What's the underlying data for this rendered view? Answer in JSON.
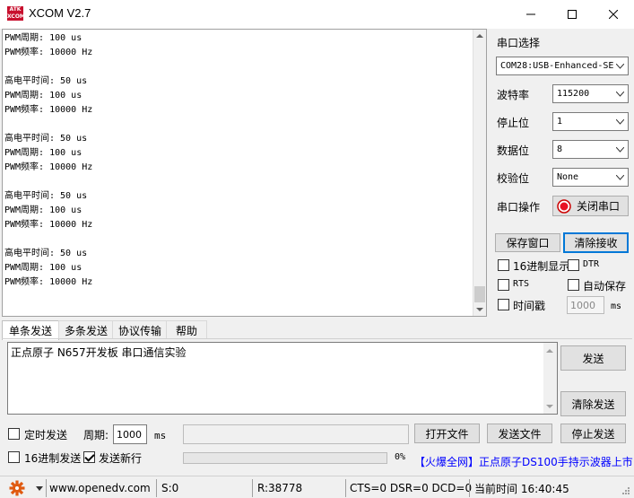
{
  "window": {
    "title": "XCOM V2.7",
    "logo_text": "ATK\nXCOM",
    "minimize": "─",
    "maximize": "☐",
    "close": "✕"
  },
  "receive": {
    "text": "PWM周期: 100 us\nPWM频率: 10000 Hz\n\n高电平时间: 50 us\nPWM周期: 100 us\nPWM频率: 10000 Hz\n\n高电平时间: 50 us\nPWM周期: 100 us\nPWM频率: 10000 Hz\n\n高电平时间: 50 us\nPWM周期: 100 us\nPWM频率: 10000 Hz\n\n高电平时间: 50 us\nPWM周期: 100 us\nPWM频率: 10000 Hz"
  },
  "settings": {
    "port_select_label": "串口选择",
    "port_value": "COM28:USB-Enhanced-SE",
    "baud_label": "波特率",
    "baud_value": "115200",
    "stopbit_label": "停止位",
    "stopbit_value": "1",
    "databit_label": "数据位",
    "databit_value": "8",
    "parity_label": "校验位",
    "parity_value": "None",
    "port_op_label": "串口操作",
    "close_port_button": "关闭串口",
    "save_window_button": "保存窗口",
    "clear_receive_button": "清除接收",
    "hex_display_label": "16进制显示",
    "dtr_label": "DTR",
    "rts_label": "RTS",
    "auto_save_label": "自动保存",
    "timestamp_label": "时间戳",
    "timestamp_value": "1000",
    "timestamp_unit": "ms"
  },
  "tabs": [
    {
      "label": "单条发送"
    },
    {
      "label": "多条发送"
    },
    {
      "label": "协议传输"
    },
    {
      "label": "帮助"
    }
  ],
  "send": {
    "text": "正点原子 N657开发板 串口通信实验",
    "send_button": "发送",
    "clear_send_button": "清除发送",
    "timed_send_label": "定时发送",
    "period_label": "周期:",
    "period_value": "1000",
    "period_unit": "ms",
    "file_path": "",
    "open_file_button": "打开文件",
    "send_file_button": "发送文件",
    "stop_send_button": "停止发送",
    "hex_send_label": "16进制发送",
    "newline_label": "发送新行",
    "progress_percent": "0%",
    "progress_value": 0,
    "ad_link_prefix": "【火爆全网】",
    "ad_link_text": "正点原子DS100手持示波器上市"
  },
  "status": {
    "url": "www.openedv.com",
    "s_count": "S:0",
    "r_count": "R:38778",
    "lines": "CTS=0 DSR=0 DCD=0",
    "time": "当前时间 16:40:45"
  },
  "colors": {
    "accent": "#0078d7",
    "link_blue": "#0000ff",
    "close_button_red": "#e81123"
  }
}
